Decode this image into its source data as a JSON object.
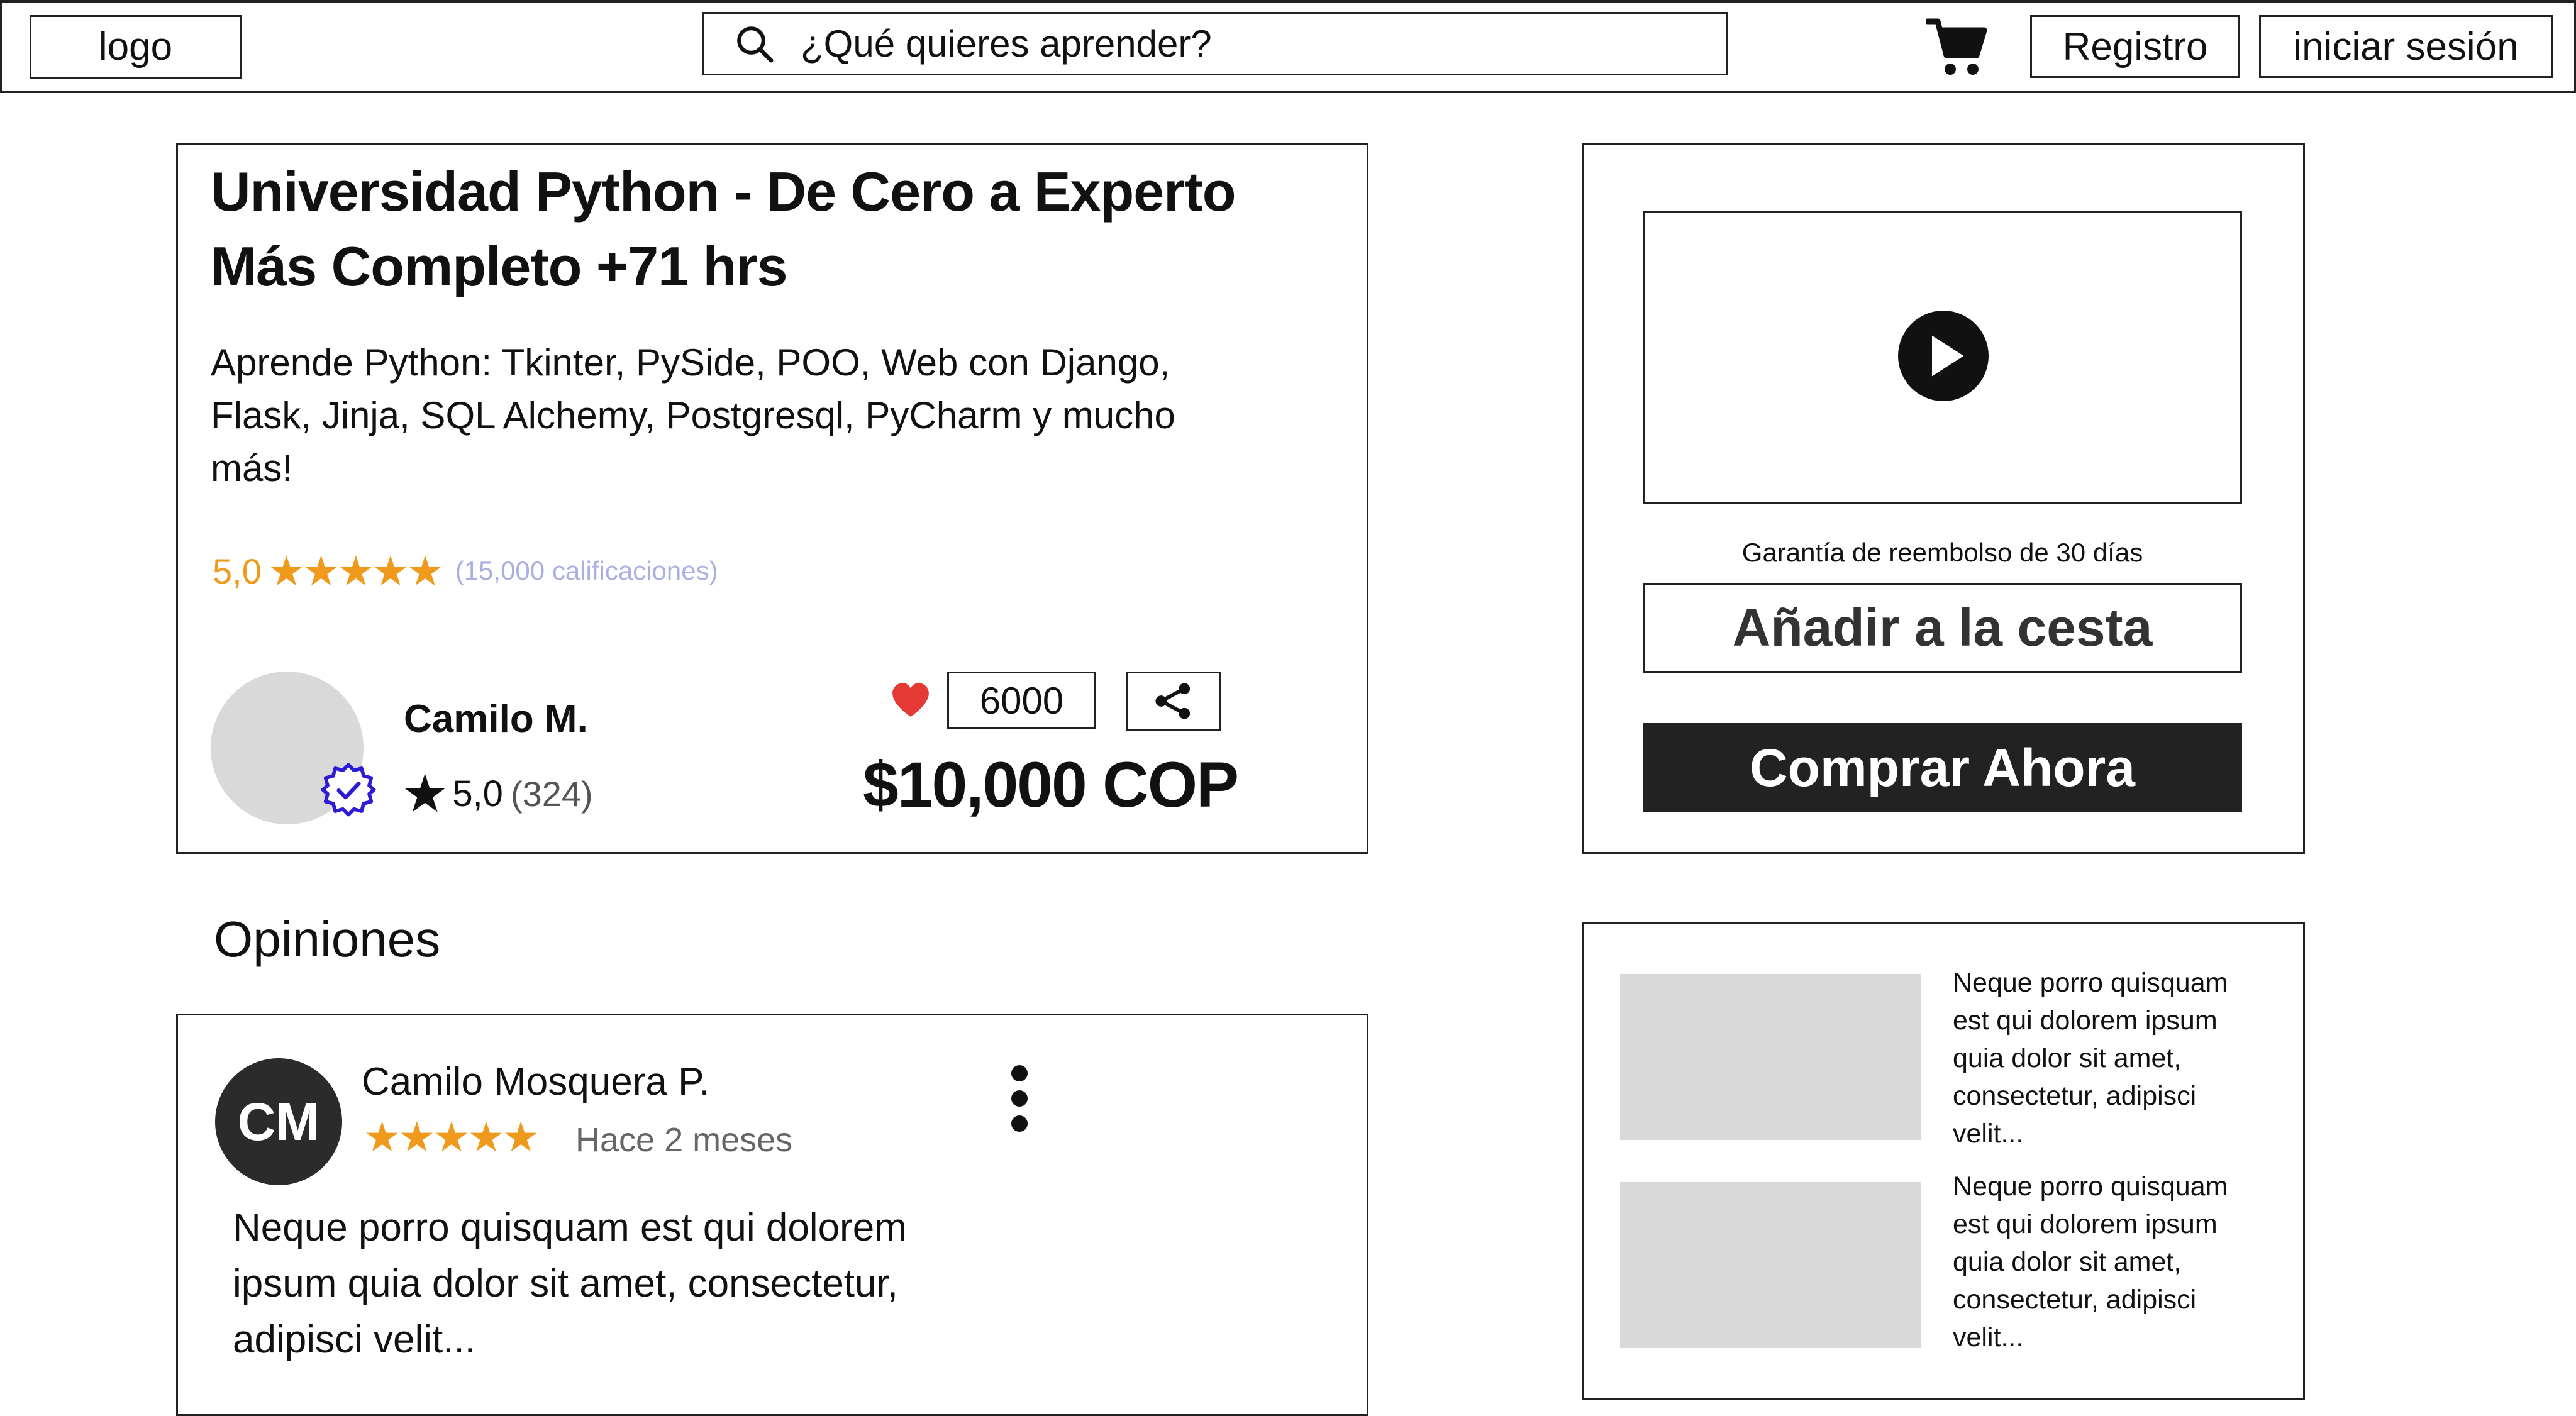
{
  "header": {
    "logo": "logo",
    "search_placeholder": "¿Qué quieres aprender?",
    "register_label": "Registro",
    "login_label": "iniciar sesión"
  },
  "course": {
    "title_line1": "Universidad Python - De Cero a Experto",
    "title_line2": "Más Completo +71 hrs",
    "description": "Aprende Python: Tkinter, PySide, POO, Web con Django, Flask, Jinja, SQL Alchemy, Postgresql, PyCharm y mucho más!",
    "rating_value": "5,0",
    "rating_stars": 5,
    "rating_count": "(15,000 calificaciones)",
    "instructor": {
      "name": "Camilo M.",
      "rating": "5,0",
      "reviews": "(324)"
    },
    "likes": "6000",
    "price": "$10,000 COP"
  },
  "purchase": {
    "guarantee": "Garantía de reembolso de 30 días",
    "add_to_cart_label": "Añadir a la cesta",
    "buy_now_label": "Comprar Ahora"
  },
  "reviews": {
    "heading": "Opiniones",
    "items": [
      {
        "initials": "CM",
        "name": "Camilo Mosquera P.",
        "stars": 5,
        "date": "Hace 2 meses",
        "text": "Neque porro quisquam est qui dolorem ipsum quia dolor sit amet, consectetur, adipisci velit..."
      }
    ]
  },
  "related": {
    "items": [
      {
        "text": "Neque porro quisquam est qui dolorem ipsum quia dolor sit amet, consectetur, adipisci velit..."
      },
      {
        "text": "Neque porro quisquam est qui dolorem ipsum quia dolor sit amet, consectetur, adipisci velit..."
      }
    ]
  },
  "colors": {
    "accent_star": "#ef9a1c",
    "rating_count": "#a9afe0",
    "heart": "#e53935",
    "verified": "#2d1bd6",
    "button_dark": "#222222",
    "placeholder_gray": "#d9d9d9"
  },
  "icons": [
    "search-icon",
    "cart-icon",
    "verified-icon",
    "heart-icon",
    "share-icon",
    "play-icon",
    "more-vertical-icon"
  ]
}
